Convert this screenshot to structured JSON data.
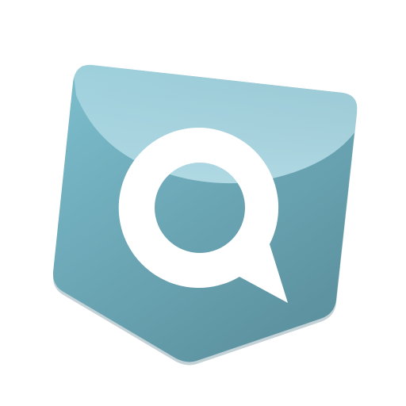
{
  "app_icon": {
    "icon": "pocket-search-icon",
    "colors": {
      "background": "#ffffff",
      "pocket_top": "#7bbccb",
      "pocket_bottom": "#5a8e9c",
      "gloss": "#b7dee8",
      "edge_shadow": "#4f7e8b",
      "glyph": "#ffffff"
    }
  }
}
